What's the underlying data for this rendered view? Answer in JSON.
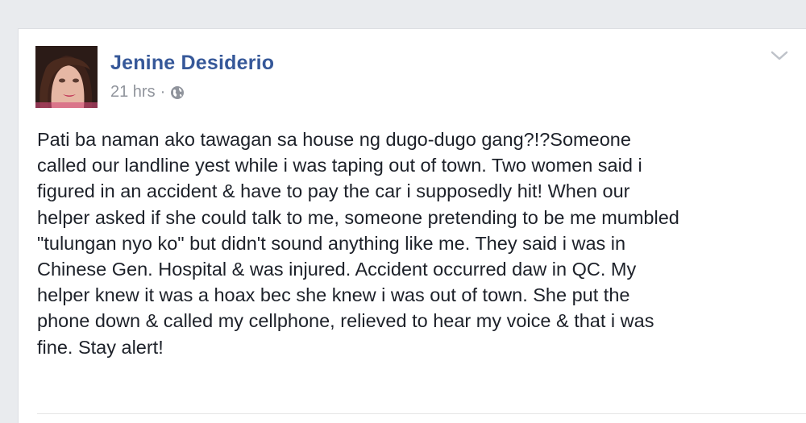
{
  "post": {
    "author": "Jenine Desiderio",
    "timestamp": "21 hrs",
    "separator": "·",
    "privacy_icon": "globe-icon",
    "menu_icon": "chevron-down-icon",
    "text": "Pati ba naman ako tawagan sa house ng dugo-dugo gang?!?Someone\ncalled our landline yest while i was taping out of town. Two women said i\nfigured in an accident & have to pay the car i supposedly hit! When our\nhelper asked if she could talk to me, someone pretending to be me mumbled\n\"tulungan nyo ko\" but didn't sound anything like me. They said i was in\nChinese Gen. Hospital & was injured. Accident occurred daw in QC. My\nhelper knew it was a hoax bec she knew i was out of town. She put the\nphone down & called my cellphone, relieved to hear my voice & that i was\nfine. Stay alert!"
  },
  "colors": {
    "author_link": "#365899",
    "meta_gray": "#90949c",
    "body_text": "#1d2129",
    "page_bg": "#e9ebee"
  }
}
